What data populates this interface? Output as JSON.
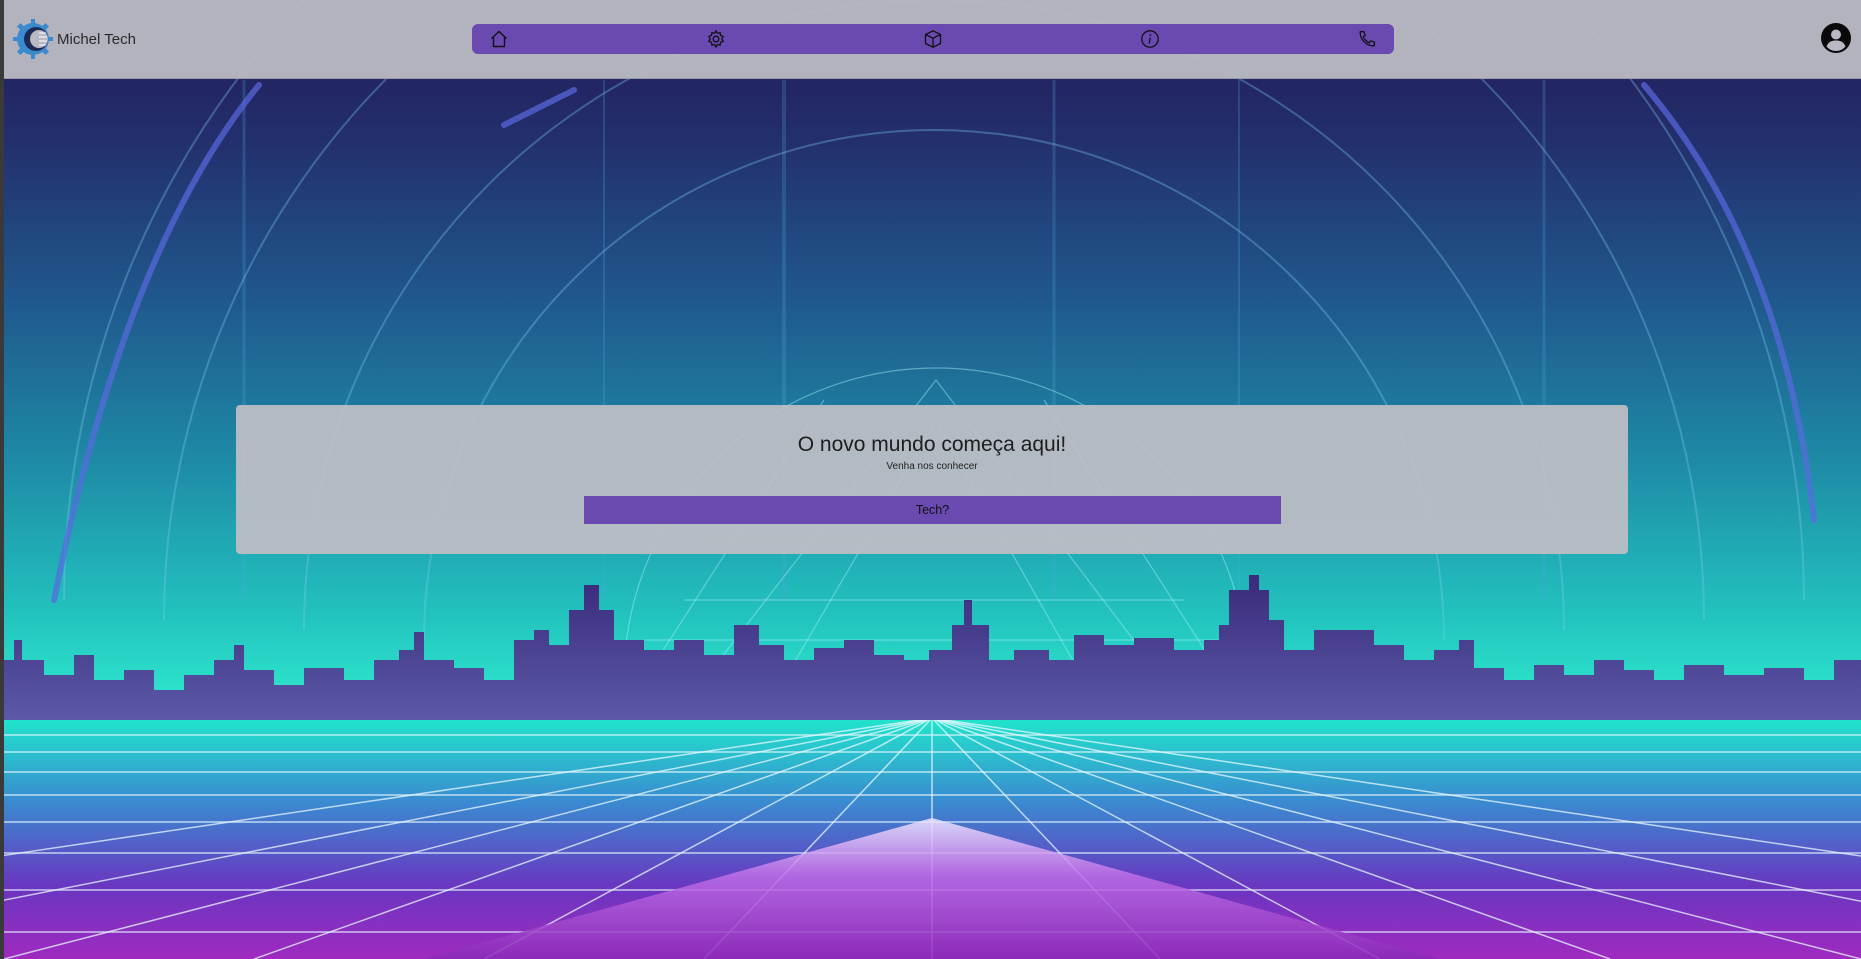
{
  "header": {
    "brand_name": "Michel Tech",
    "nav": [
      {
        "name": "home",
        "icon": "home-icon"
      },
      {
        "name": "settings",
        "icon": "gear-icon"
      },
      {
        "name": "products",
        "icon": "box-icon"
      },
      {
        "name": "about",
        "icon": "info-icon"
      },
      {
        "name": "contact",
        "icon": "phone-icon"
      }
    ],
    "profile_icon": "user-circle-icon"
  },
  "hero": {
    "title": "O novo mundo começa aqui!",
    "subtitle": "Venha nos conhecer",
    "button_label": "Tech?"
  },
  "colors": {
    "accent": "#6a4ab0",
    "header_bg": "#b9b9c3",
    "card_bg": "#bebec4"
  }
}
